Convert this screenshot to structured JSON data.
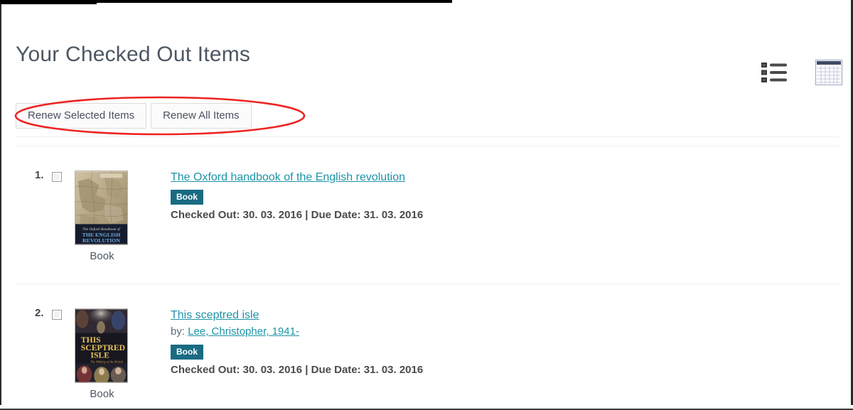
{
  "header": {
    "title": "Your Checked Out Items"
  },
  "view_toggles": [
    {
      "name": "list-view",
      "icon": "list-view-icon"
    },
    {
      "name": "grid-view",
      "icon": "grid-view-icon"
    }
  ],
  "toolbar": {
    "renew_selected_label": "Renew Selected Items",
    "renew_all_label": "Renew All Items"
  },
  "annotation": {
    "type": "ellipse-highlight",
    "color": "#ee2222"
  },
  "colors": {
    "link": "#1d94a8",
    "badge": "#196b82",
    "title": "#4c5763",
    "annotation": "#ee2222"
  },
  "items": [
    {
      "index": "1.",
      "title": "The Oxford handbook of the English revolution",
      "author_prefix": "",
      "author": "",
      "format_badge": "Book",
      "dates": "Checked Out: 30. 03. 2016 | Due Date: 31. 03. 2016",
      "checked_out": "30. 03. 2016",
      "due_date": "31. 03. 2016",
      "cover_caption": "Book",
      "cover_alt": "The Oxford Handbook of THE ENGLISH REVOLUTION"
    },
    {
      "index": "2.",
      "title": "This sceptred isle",
      "author_prefix": "by:",
      "author": "Lee, Christopher, 1941-",
      "format_badge": "Book",
      "dates": "Checked Out: 30. 03. 2016 | Due Date: 31. 03. 2016",
      "checked_out": "30. 03. 2016",
      "due_date": "31. 03. 2016",
      "cover_caption": "Book",
      "cover_alt": "THIS SCEPTRED ISLE The Making of the British"
    }
  ]
}
